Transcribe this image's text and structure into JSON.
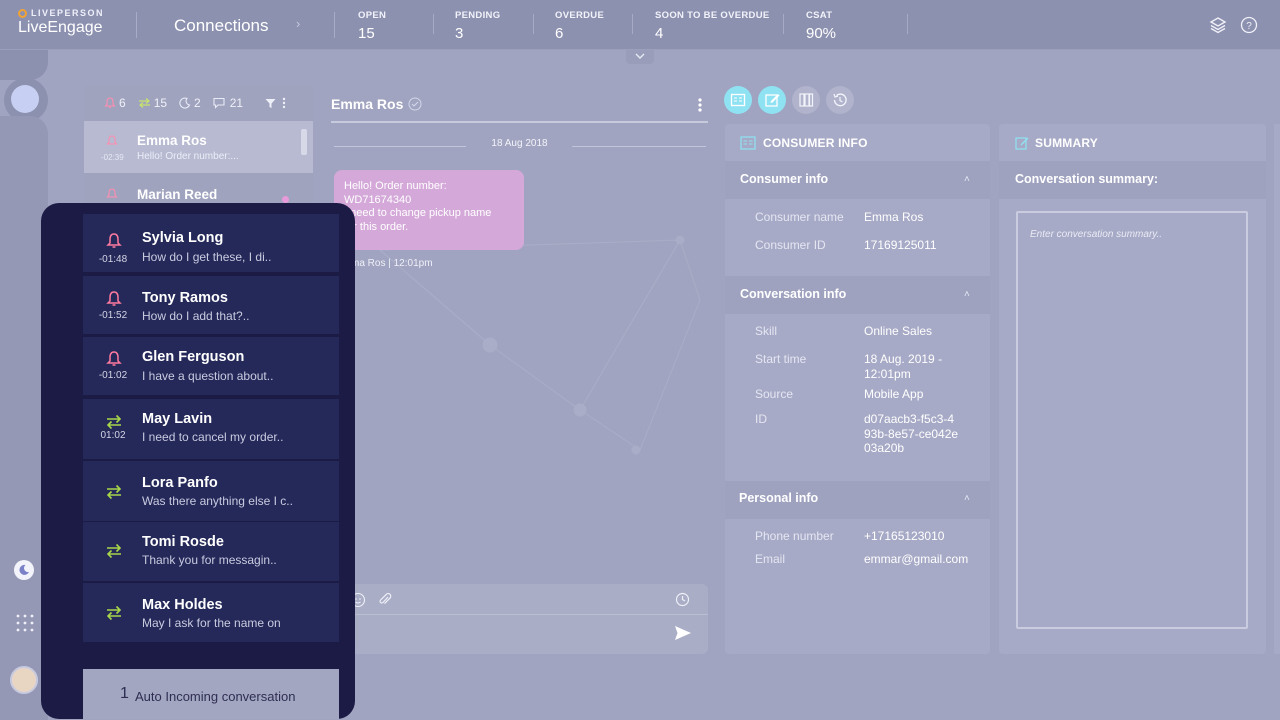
{
  "brand": {
    "company": "LIVEPERSON",
    "product": "LiveEngage"
  },
  "header": {
    "page_title": "Connections",
    "kpis": [
      {
        "label": "OPEN",
        "value": "15"
      },
      {
        "label": "PENDING",
        "value": "3"
      },
      {
        "label": "OVERDUE",
        "value": "6"
      },
      {
        "label": "SOON TO BE OVERDUE",
        "value": "4"
      },
      {
        "label": "CSAT",
        "value": "90%"
      }
    ]
  },
  "list": {
    "counts": {
      "alerts": "6",
      "transfers": "15",
      "away": "2",
      "messages": "21"
    },
    "rows": [
      {
        "name": "Emma Ros",
        "preview": "Hello! Order number:...",
        "time": "-02:39"
      },
      {
        "name": "Marian Reed",
        "preview": "",
        "time": ""
      }
    ]
  },
  "chat": {
    "consumer_name": "Emma Ros",
    "date": "18 Aug 2018",
    "message_lines": [
      "Hello! Order number:",
      "WD71674340",
      "I need to change pickup name",
      "for this order."
    ],
    "message_meta": "Emma Ros  |  12:01pm"
  },
  "consumer_info": {
    "card_title": "CONSUMER INFO",
    "consumer_section": "Consumer info",
    "consumer_name_label": "Consumer name",
    "consumer_name": "Emma Ros",
    "consumer_id_label": "Consumer ID",
    "consumer_id": "17169125011",
    "conversation_section": "Conversation info",
    "skill_label": "Skill",
    "skill": "Online Sales",
    "start_label": "Start time",
    "start": "18 Aug. 2019 - 12:01pm",
    "source_label": "Source",
    "source": "Mobile App",
    "id_label": "ID",
    "id": "d07aacb3-f5c3-493b-8e57-ce042e03a20b",
    "personal_section": "Personal info",
    "phone_label": "Phone number",
    "phone": "+17165123010",
    "email_label": "Email",
    "email": "emmar@gmail.com"
  },
  "summary": {
    "card_title": "SUMMARY",
    "label": "Conversation summary:",
    "placeholder": "Enter conversation summary.."
  },
  "overlay": {
    "rows": [
      {
        "name": "Sylvia Long",
        "preview": "How do I get these, I di..",
        "time": "-01:48",
        "icon": "bell-icon"
      },
      {
        "name": "Tony Ramos",
        "preview": "How do I add that?..",
        "time": "-01:52",
        "icon": "bell-icon"
      },
      {
        "name": "Glen Ferguson",
        "preview": "I have a question about..",
        "time": "-01:02",
        "icon": "bell-icon"
      },
      {
        "name": "May Lavin",
        "preview": "I need to cancel my order..",
        "time": "01:02",
        "icon": "transfer-icon"
      },
      {
        "name": "Lora Panfo",
        "preview": "Was there anything else I c..",
        "time": "",
        "icon": "transfer-icon"
      },
      {
        "name": "Tomi Rosde",
        "preview": "Thank you for messagin..",
        "time": "",
        "icon": "transfer-icon"
      },
      {
        "name": "Max Holdes",
        "preview": "May I ask for the name on",
        "time": "",
        "icon": "transfer-icon"
      }
    ],
    "footer_count": "1",
    "footer_text": "Auto Incoming conversation"
  },
  "colors": {
    "accent_cyan": "#8fe2f2",
    "alert_pink": "#ff7aa0",
    "transfer_lime": "#a8d64a",
    "overlay_bg": "#1c1b46",
    "bubble": "#d4a9d9"
  }
}
